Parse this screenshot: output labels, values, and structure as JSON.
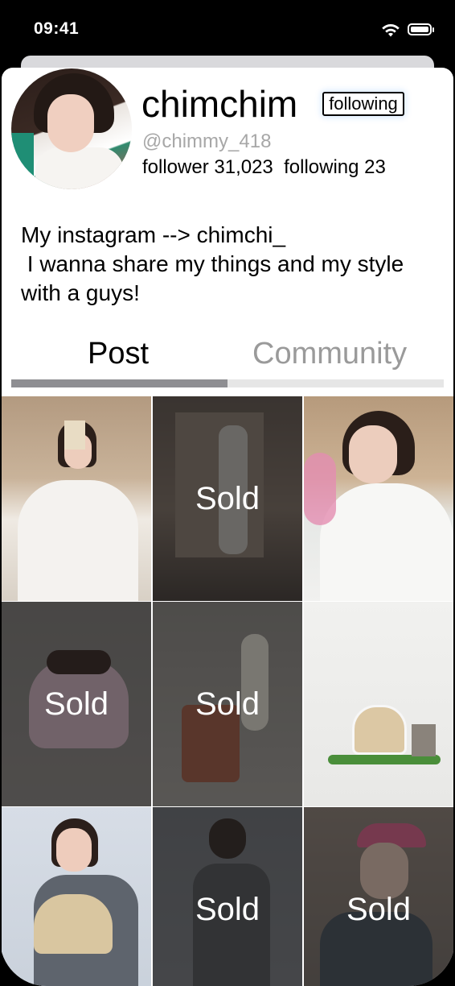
{
  "status_bar": {
    "time": "09:41"
  },
  "profile": {
    "username": "chimchim",
    "follow_button_label": "following",
    "handle": "@chimmy_418",
    "counts_text": "follower 31,023  following 23",
    "bio_lines": [
      "My instagram --> chimchi_",
      " I wanna share my things and my style",
      "with a guys!"
    ]
  },
  "tabs": [
    {
      "label": "Post",
      "active": true
    },
    {
      "label": "Community",
      "active": false
    }
  ],
  "tab_progress_fraction": 0.5,
  "posts": [
    {
      "label": "",
      "sold": false
    },
    {
      "label": "Sold",
      "sold": true
    },
    {
      "label": "",
      "sold": false
    },
    {
      "label": "Sold",
      "sold": true
    },
    {
      "label": "Sold",
      "sold": true
    },
    {
      "label": "",
      "sold": false
    },
    {
      "label": "",
      "sold": false
    },
    {
      "label": "Sold",
      "sold": true
    },
    {
      "label": "Sold",
      "sold": true
    }
  ]
}
